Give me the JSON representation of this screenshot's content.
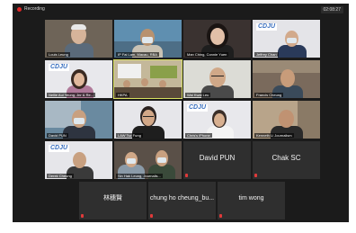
{
  "topbar": {
    "recording_label": "Recording",
    "timer": "02:08:27"
  },
  "participants": [
    {
      "name": "Louis Leung"
    },
    {
      "name": "IP Fai Lam, Macau, RBA"
    },
    {
      "name": "Man Ching, Connie Yuen"
    },
    {
      "name": "Jeffrey Chan"
    },
    {
      "name": "Nellie Aui Yeung, Jnr & Re..."
    },
    {
      "name": "HKPA"
    },
    {
      "name": "Wai Kwai Leu"
    },
    {
      "name": "Francis Cheung"
    },
    {
      "name": "David PUN"
    },
    {
      "name": "LAW Tsz Fung"
    },
    {
      "name": "Chris's iPhone"
    },
    {
      "name": "Kenneth Li Journalism"
    },
    {
      "name": "Derek Cheung"
    },
    {
      "name": "Sin Hak Leung, Journalis..."
    },
    {
      "name": "David PUN"
    },
    {
      "name": "Chak SC"
    },
    {
      "name": "林穗賢"
    },
    {
      "name": "chung ho cheung_bu..."
    },
    {
      "name": "tim wong"
    }
  ],
  "colors": {
    "background": "#1b1b1b",
    "tile": "#2f2f2f",
    "muted_mic": "#e03a3a",
    "recording_dot": "#e02828"
  },
  "logo_text": "CDJU"
}
